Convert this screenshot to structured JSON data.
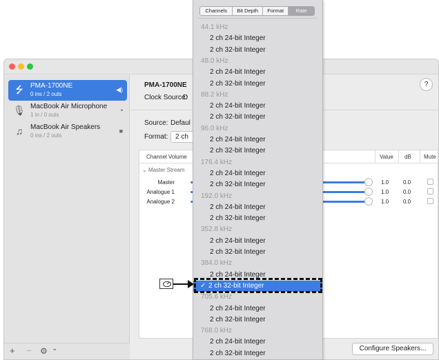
{
  "sidebar": {
    "devices": [
      {
        "name": "PMA-1700NE",
        "sub": "0 ins / 2 outs",
        "icon": "usb-icon",
        "right_icon": "speaker-volume-icon",
        "selected": true
      },
      {
        "name": "MacBook Air Microphone",
        "sub": "1 in / 0 outs",
        "icon": "microphone-icon",
        "right_icon": "microphone-small-icon",
        "selected": false
      },
      {
        "name": "MacBook Air Speakers",
        "sub": "0 ins / 2 outs",
        "icon": "speakers-icon",
        "right_icon": "finder-icon",
        "selected": false
      }
    ],
    "bottom": {
      "add": "+",
      "remove": "−",
      "gear": "⚙",
      "chevron": "⌄"
    }
  },
  "main": {
    "device_title": "PMA-1700NE",
    "clock_source_label": "Clock Source:",
    "clock_source_value": "D",
    "help": "?",
    "source_label": "Source:",
    "source_value": "Defaul",
    "format_label": "Format:",
    "format_value": "2 ch",
    "table": {
      "headers": {
        "channel_volume": "Channel Volume",
        "value": "Value",
        "db": "dB",
        "mute": "Mute"
      },
      "stream": "Master Stream",
      "channels": [
        {
          "name": "Master",
          "value": "1.0",
          "db": "0.0"
        },
        {
          "name": "Analogue 1",
          "value": "1.0",
          "db": "0.0"
        },
        {
          "name": "Analogue 2",
          "value": "1.0",
          "db": "0.0"
        }
      ]
    },
    "configure_button": "Configure Speakers..."
  },
  "menu": {
    "segments": [
      "Channels",
      "Bit Depth",
      "Format",
      "Rate"
    ],
    "active_segment": "Rate",
    "items": [
      {
        "type": "header",
        "label": "44.1 kHz"
      },
      {
        "type": "option",
        "label": "2 ch 24-bit Integer"
      },
      {
        "type": "option",
        "label": "2 ch 32-bit Integer"
      },
      {
        "type": "header",
        "label": "48.0 kHz"
      },
      {
        "type": "option",
        "label": "2 ch 24-bit Integer"
      },
      {
        "type": "option",
        "label": "2 ch 32-bit Integer"
      },
      {
        "type": "header",
        "label": "88.2 kHz"
      },
      {
        "type": "option",
        "label": "2 ch 24-bit Integer"
      },
      {
        "type": "option",
        "label": "2 ch 32-bit Integer"
      },
      {
        "type": "header",
        "label": "96.0 kHz"
      },
      {
        "type": "option",
        "label": "2 ch 24-bit Integer"
      },
      {
        "type": "option",
        "label": "2 ch 32-bit Integer"
      },
      {
        "type": "header",
        "label": "176.4 kHz"
      },
      {
        "type": "option",
        "label": "2 ch 24-bit Integer"
      },
      {
        "type": "option",
        "label": "2 ch 32-bit Integer"
      },
      {
        "type": "header",
        "label": "192.0 kHz"
      },
      {
        "type": "option",
        "label": "2 ch 24-bit Integer"
      },
      {
        "type": "option",
        "label": "2 ch 32-bit Integer"
      },
      {
        "type": "header",
        "label": "352.8 kHz"
      },
      {
        "type": "option",
        "label": "2 ch 24-bit Integer"
      },
      {
        "type": "option",
        "label": "2 ch 32-bit Integer"
      },
      {
        "type": "header",
        "label": "384.0 kHz"
      },
      {
        "type": "option",
        "label": "2 ch 24-bit Integer"
      },
      {
        "type": "option",
        "label": "2 ch 32-bit Integer",
        "selected": true,
        "check": "✓"
      },
      {
        "type": "header",
        "label": "705.6 kHz"
      },
      {
        "type": "option",
        "label": "2 ch 24-bit Integer"
      },
      {
        "type": "option",
        "label": "2 ch 32-bit Integer"
      },
      {
        "type": "header",
        "label": "768.0 kHz"
      },
      {
        "type": "option",
        "label": "2 ch 24-bit Integer"
      },
      {
        "type": "option",
        "label": "2 ch 32-bit Integer"
      }
    ]
  },
  "colors": {
    "accent": "#3b7de0",
    "window_bg": "#ececec",
    "menu_bg": "#dcdcdf"
  }
}
